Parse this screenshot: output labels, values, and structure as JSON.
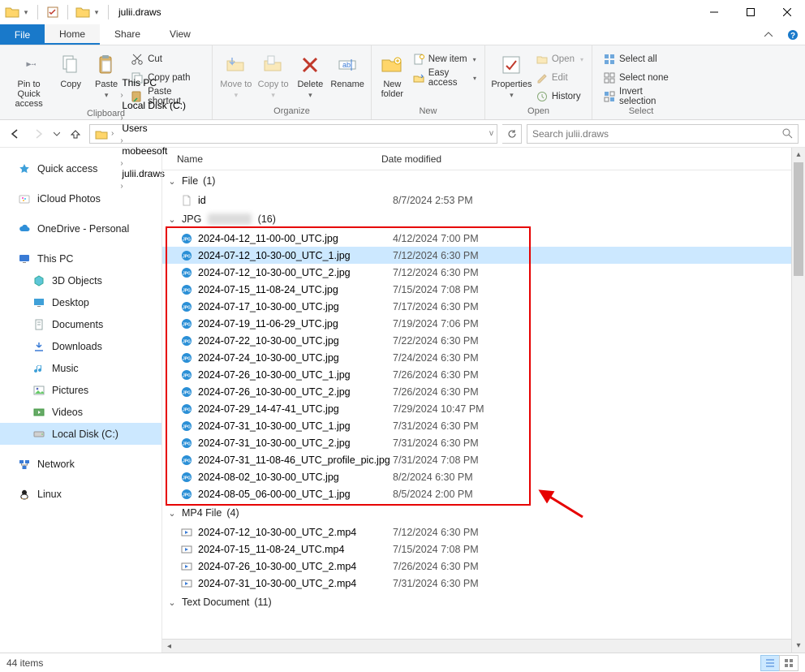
{
  "window": {
    "title": "julii.draws",
    "min": "Minimize",
    "max": "Maximize",
    "close": "Close"
  },
  "tabs": {
    "file": "File",
    "home": "Home",
    "share": "Share",
    "view": "View"
  },
  "ribbon": {
    "clipboard": {
      "label": "Clipboard",
      "pin": "Pin to Quick access",
      "copy": "Copy",
      "paste": "Paste",
      "cut": "Cut",
      "copypath": "Copy path",
      "pasteshortcut": "Paste shortcut"
    },
    "organize": {
      "label": "Organize",
      "moveto": "Move to",
      "copyto": "Copy to",
      "delete": "Delete",
      "rename": "Rename"
    },
    "new": {
      "label": "New",
      "newfolder": "New folder",
      "newitem": "New item",
      "easyaccess": "Easy access"
    },
    "open": {
      "label": "Open",
      "properties": "Properties",
      "open": "Open",
      "edit": "Edit",
      "history": "History"
    },
    "select": {
      "label": "Select",
      "selectall": "Select all",
      "selectnone": "Select none",
      "invert": "Invert selection"
    }
  },
  "breadcrumb": {
    "segs": [
      "This PC",
      "Local Disk (C:)",
      "Users",
      "mobeesoft",
      "julii.draws"
    ]
  },
  "search": {
    "placeholder": "Search julii.draws"
  },
  "nav": {
    "quick": "Quick access",
    "icloud": "iCloud Photos",
    "onedrive": "OneDrive - Personal",
    "thispc": "This PC",
    "thispc_children": [
      "3D Objects",
      "Desktop",
      "Documents",
      "Downloads",
      "Music",
      "Pictures",
      "Videos",
      "Local Disk (C:)"
    ],
    "network": "Network",
    "linux": "Linux"
  },
  "columns": {
    "name": "Name",
    "date": "Date modified"
  },
  "groups": {
    "file": {
      "label": "File",
      "count": "(1)",
      "items": [
        {
          "name": "id",
          "date": "8/7/2024 2:53 PM",
          "type": "generic"
        }
      ]
    },
    "jpg": {
      "label": "JPG",
      "obscured": true,
      "count": "(16)",
      "items": [
        {
          "name": "2024-04-12_11-00-00_UTC.jpg",
          "date": "4/12/2024 7:00 PM"
        },
        {
          "name": "2024-07-12_10-30-00_UTC_1.jpg",
          "date": "7/12/2024 6:30 PM",
          "selected": true
        },
        {
          "name": "2024-07-12_10-30-00_UTC_2.jpg",
          "date": "7/12/2024 6:30 PM"
        },
        {
          "name": "2024-07-15_11-08-24_UTC.jpg",
          "date": "7/15/2024 7:08 PM"
        },
        {
          "name": "2024-07-17_10-30-00_UTC.jpg",
          "date": "7/17/2024 6:30 PM"
        },
        {
          "name": "2024-07-19_11-06-29_UTC.jpg",
          "date": "7/19/2024 7:06 PM"
        },
        {
          "name": "2024-07-22_10-30-00_UTC.jpg",
          "date": "7/22/2024 6:30 PM"
        },
        {
          "name": "2024-07-24_10-30-00_UTC.jpg",
          "date": "7/24/2024 6:30 PM"
        },
        {
          "name": "2024-07-26_10-30-00_UTC_1.jpg",
          "date": "7/26/2024 6:30 PM"
        },
        {
          "name": "2024-07-26_10-30-00_UTC_2.jpg",
          "date": "7/26/2024 6:30 PM"
        },
        {
          "name": "2024-07-29_14-47-41_UTC.jpg",
          "date": "7/29/2024 10:47 PM"
        },
        {
          "name": "2024-07-31_10-30-00_UTC_1.jpg",
          "date": "7/31/2024 6:30 PM"
        },
        {
          "name": "2024-07-31_10-30-00_UTC_2.jpg",
          "date": "7/31/2024 6:30 PM"
        },
        {
          "name": "2024-07-31_11-08-46_UTC_profile_pic.jpg",
          "date": "7/31/2024 7:08 PM"
        },
        {
          "name": "2024-08-02_10-30-00_UTC.jpg",
          "date": "8/2/2024 6:30 PM"
        },
        {
          "name": "2024-08-05_06-00-00_UTC_1.jpg",
          "date": "8/5/2024 2:00 PM"
        }
      ]
    },
    "mp4": {
      "label": "MP4 File",
      "count": "(4)",
      "items": [
        {
          "name": "2024-07-12_10-30-00_UTC_2.mp4",
          "date": "7/12/2024 6:30 PM"
        },
        {
          "name": "2024-07-15_11-08-24_UTC.mp4",
          "date": "7/15/2024 7:08 PM"
        },
        {
          "name": "2024-07-26_10-30-00_UTC_2.mp4",
          "date": "7/26/2024 6:30 PM"
        },
        {
          "name": "2024-07-31_10-30-00_UTC_2.mp4",
          "date": "7/31/2024 6:30 PM"
        }
      ]
    },
    "txt": {
      "label": "Text Document",
      "count": "(11)"
    }
  },
  "status": {
    "items": "44 items"
  }
}
